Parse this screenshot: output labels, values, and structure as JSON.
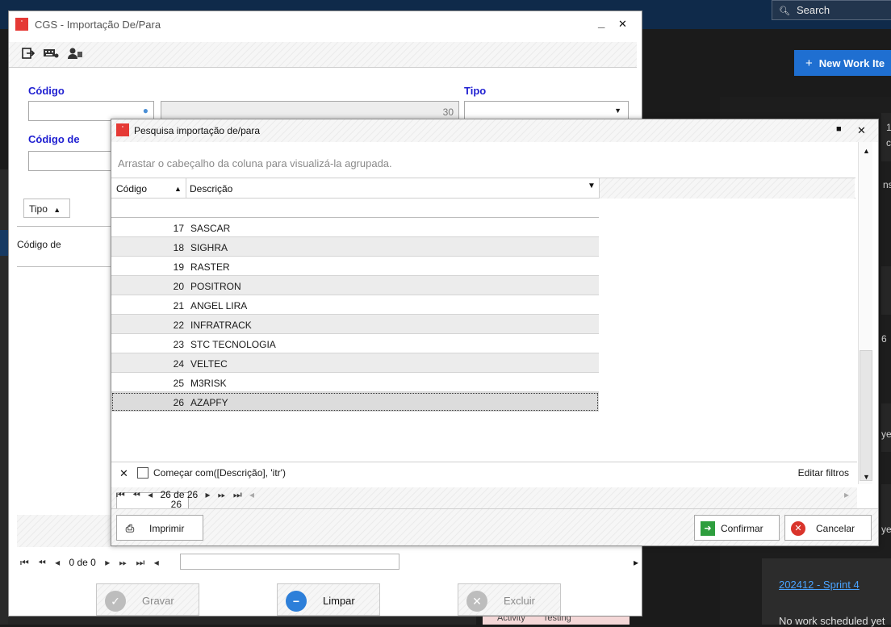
{
  "background": {
    "search_placeholder": "Search",
    "new_work_item": "New Work Ite",
    "sprint_link": "202412 - Sprint 4",
    "sprint_note": "No work scheduled yet",
    "activity_label": "Activity",
    "activity_value": "Testing",
    "fragments": [
      "1",
      "c",
      "ns",
      "6",
      "yet",
      "yet"
    ]
  },
  "main": {
    "title": "CGS - Importação De/Para",
    "minimize": "_",
    "close": "✕",
    "codigo_label": "Código",
    "tipo_label": "Tipo",
    "codigo_de_label": "Código de",
    "readonly_value": "30",
    "tipo_column": "Tipo",
    "group_row": "Código de",
    "nav_text": "0 de 0",
    "buttons": {
      "save": "Gravar",
      "clear": "Limpar",
      "delete": "Excluir"
    }
  },
  "dialog": {
    "title": "Pesquisa importação de/para",
    "group_hint": "Arrastar o cabeçalho da coluna para visualizá-la agrupada.",
    "columns": {
      "codigo": "Código",
      "descricao": "Descrição"
    },
    "rows": [
      {
        "codigo": "17",
        "descricao": "SASCAR"
      },
      {
        "codigo": "18",
        "descricao": "SIGHRA"
      },
      {
        "codigo": "19",
        "descricao": "RASTER"
      },
      {
        "codigo": "20",
        "descricao": "POSITRON"
      },
      {
        "codigo": "21",
        "descricao": "ANGEL LIRA"
      },
      {
        "codigo": "22",
        "descricao": "INFRATRACK"
      },
      {
        "codigo": "23",
        "descricao": "STC TECNOLOGIA"
      },
      {
        "codigo": "24",
        "descricao": "VELTEC"
      },
      {
        "codigo": "25",
        "descricao": "M3RISK"
      },
      {
        "codigo": "26",
        "descricao": "AZAPFY"
      }
    ],
    "selected_index": 9,
    "count_value": "26",
    "filter_text": "Começar com([Descrição], 'itr')",
    "edit_filters": "Editar filtros",
    "nav_text": "26 de 26",
    "buttons": {
      "print": "Imprimir",
      "confirm": "Confirmar",
      "cancel": "Cancelar"
    }
  },
  "colors": {
    "accent_blue": "#1f1fd1",
    "logo_red": "#e53935",
    "confirm_green": "#2e9e3e",
    "cancel_red": "#d9342b"
  }
}
